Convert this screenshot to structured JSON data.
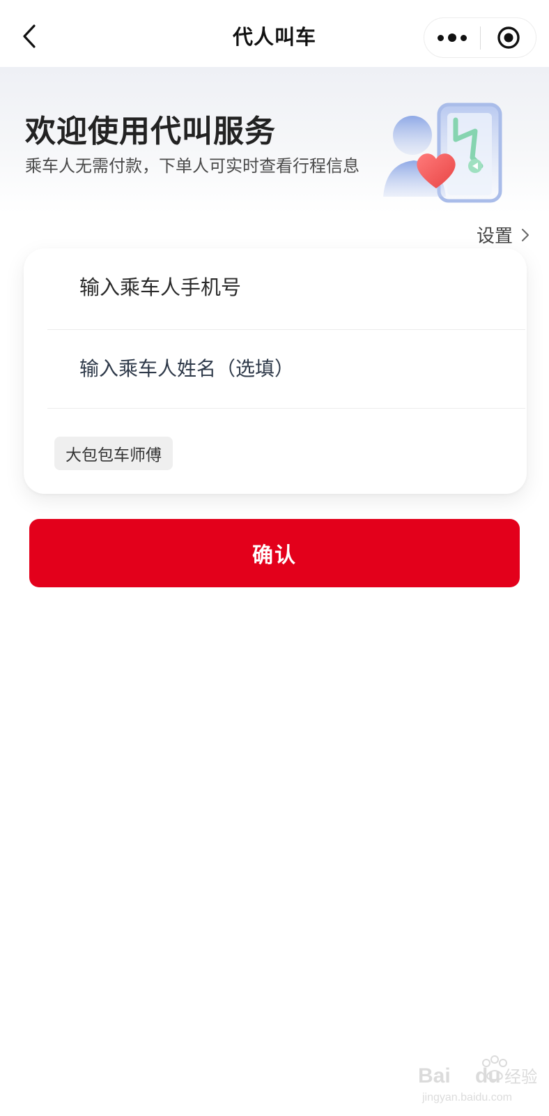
{
  "navbar": {
    "title": "代人叫车",
    "back_icon": "chevron-left-icon",
    "more_icon": "more-dots-icon",
    "close_icon": "target-circle-icon"
  },
  "hero": {
    "title": "欢迎使用代叫服务",
    "subtitle": "乘车人无需付款，下单人可实时查看行程信息",
    "illustration": "person-heart-phone-map-illustration"
  },
  "settings": {
    "label": "设置",
    "chevron_icon": "chevron-right-icon"
  },
  "form": {
    "phone_placeholder": "输入乘车人手机号",
    "name_placeholder": "输入乘车人姓名（选填）",
    "tags": [
      "大包包车师傅"
    ]
  },
  "confirm": {
    "label": "确认"
  },
  "colors": {
    "primary": "#e3001b",
    "hero_bg": "#eef0f5",
    "tag_bg": "#efefef",
    "text": "#222222"
  },
  "watermark": {
    "brand": "Baidu经验",
    "url": "jingyan.baidu.com"
  }
}
